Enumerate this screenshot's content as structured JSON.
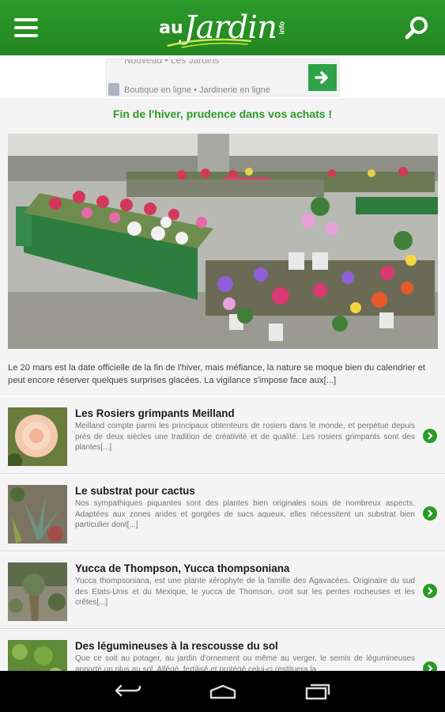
{
  "app": {
    "logo_au": "au",
    "logo_jardin": "Jardin",
    "logo_info": "info"
  },
  "ad": {
    "line1": "Nouveau • Les Jardins",
    "line2": "Boutique en ligne • Jardinerie en ligne"
  },
  "featured": {
    "title": "Fin de l'hiver, prudence dans vos achats !",
    "excerpt": "Le 20 mars est la date officielle de la fin de l'hiver, mais méfiance, la nature se moque bien du calendrier et peut encore réserver quelques surprises glacées. La vigilance s'impose face aux[...]"
  },
  "articles": [
    {
      "title": "Les Rosiers grimpants Meilland",
      "text": "Meilland compte parmi les principaux obtenteurs de rosiers dans le monde, et perpétue depuis près de deux siècles une tradition de créativité et de qualité. Les rosiers grimpants sont des plantes[...]"
    },
    {
      "title": "Le substrat pour cactus",
      "text": "Nos sympathiques piquantes sont des plantes bien originales sous de nombreux aspects. Adaptées aux zones arides et gorgées de sucs aqueux, elles nécessitent un substrat bien particulier dont[...]"
    },
    {
      "title": "Yucca de Thompson, Yucca thompsoniana",
      "text": "Yucca thompsoniana, est une plante xérophyte de la famille des Agavacées. Originaire du sud des Etats-Unis et du Mexique, le yucca de Thomson, croit sur les pentes rocheuses et les crêtes[...]"
    },
    {
      "title": "Des légumineuses à la rescousse du sol",
      "text": "Que ce soit au potager, au jardin d'ornement ou même au verger, le semis de légumineuses apporte un plus au sol. Allégé, fertilisé et protégé celui-ci restituera la"
    }
  ],
  "colors": {
    "brand_green": "#2a9a26",
    "appbar_green": "#23861f"
  },
  "icons": {
    "menu": "menu-icon",
    "search": "search-icon",
    "chevron": "chevron-right-icon",
    "back": "back-icon",
    "home": "home-icon",
    "recents": "recent-apps-icon"
  }
}
